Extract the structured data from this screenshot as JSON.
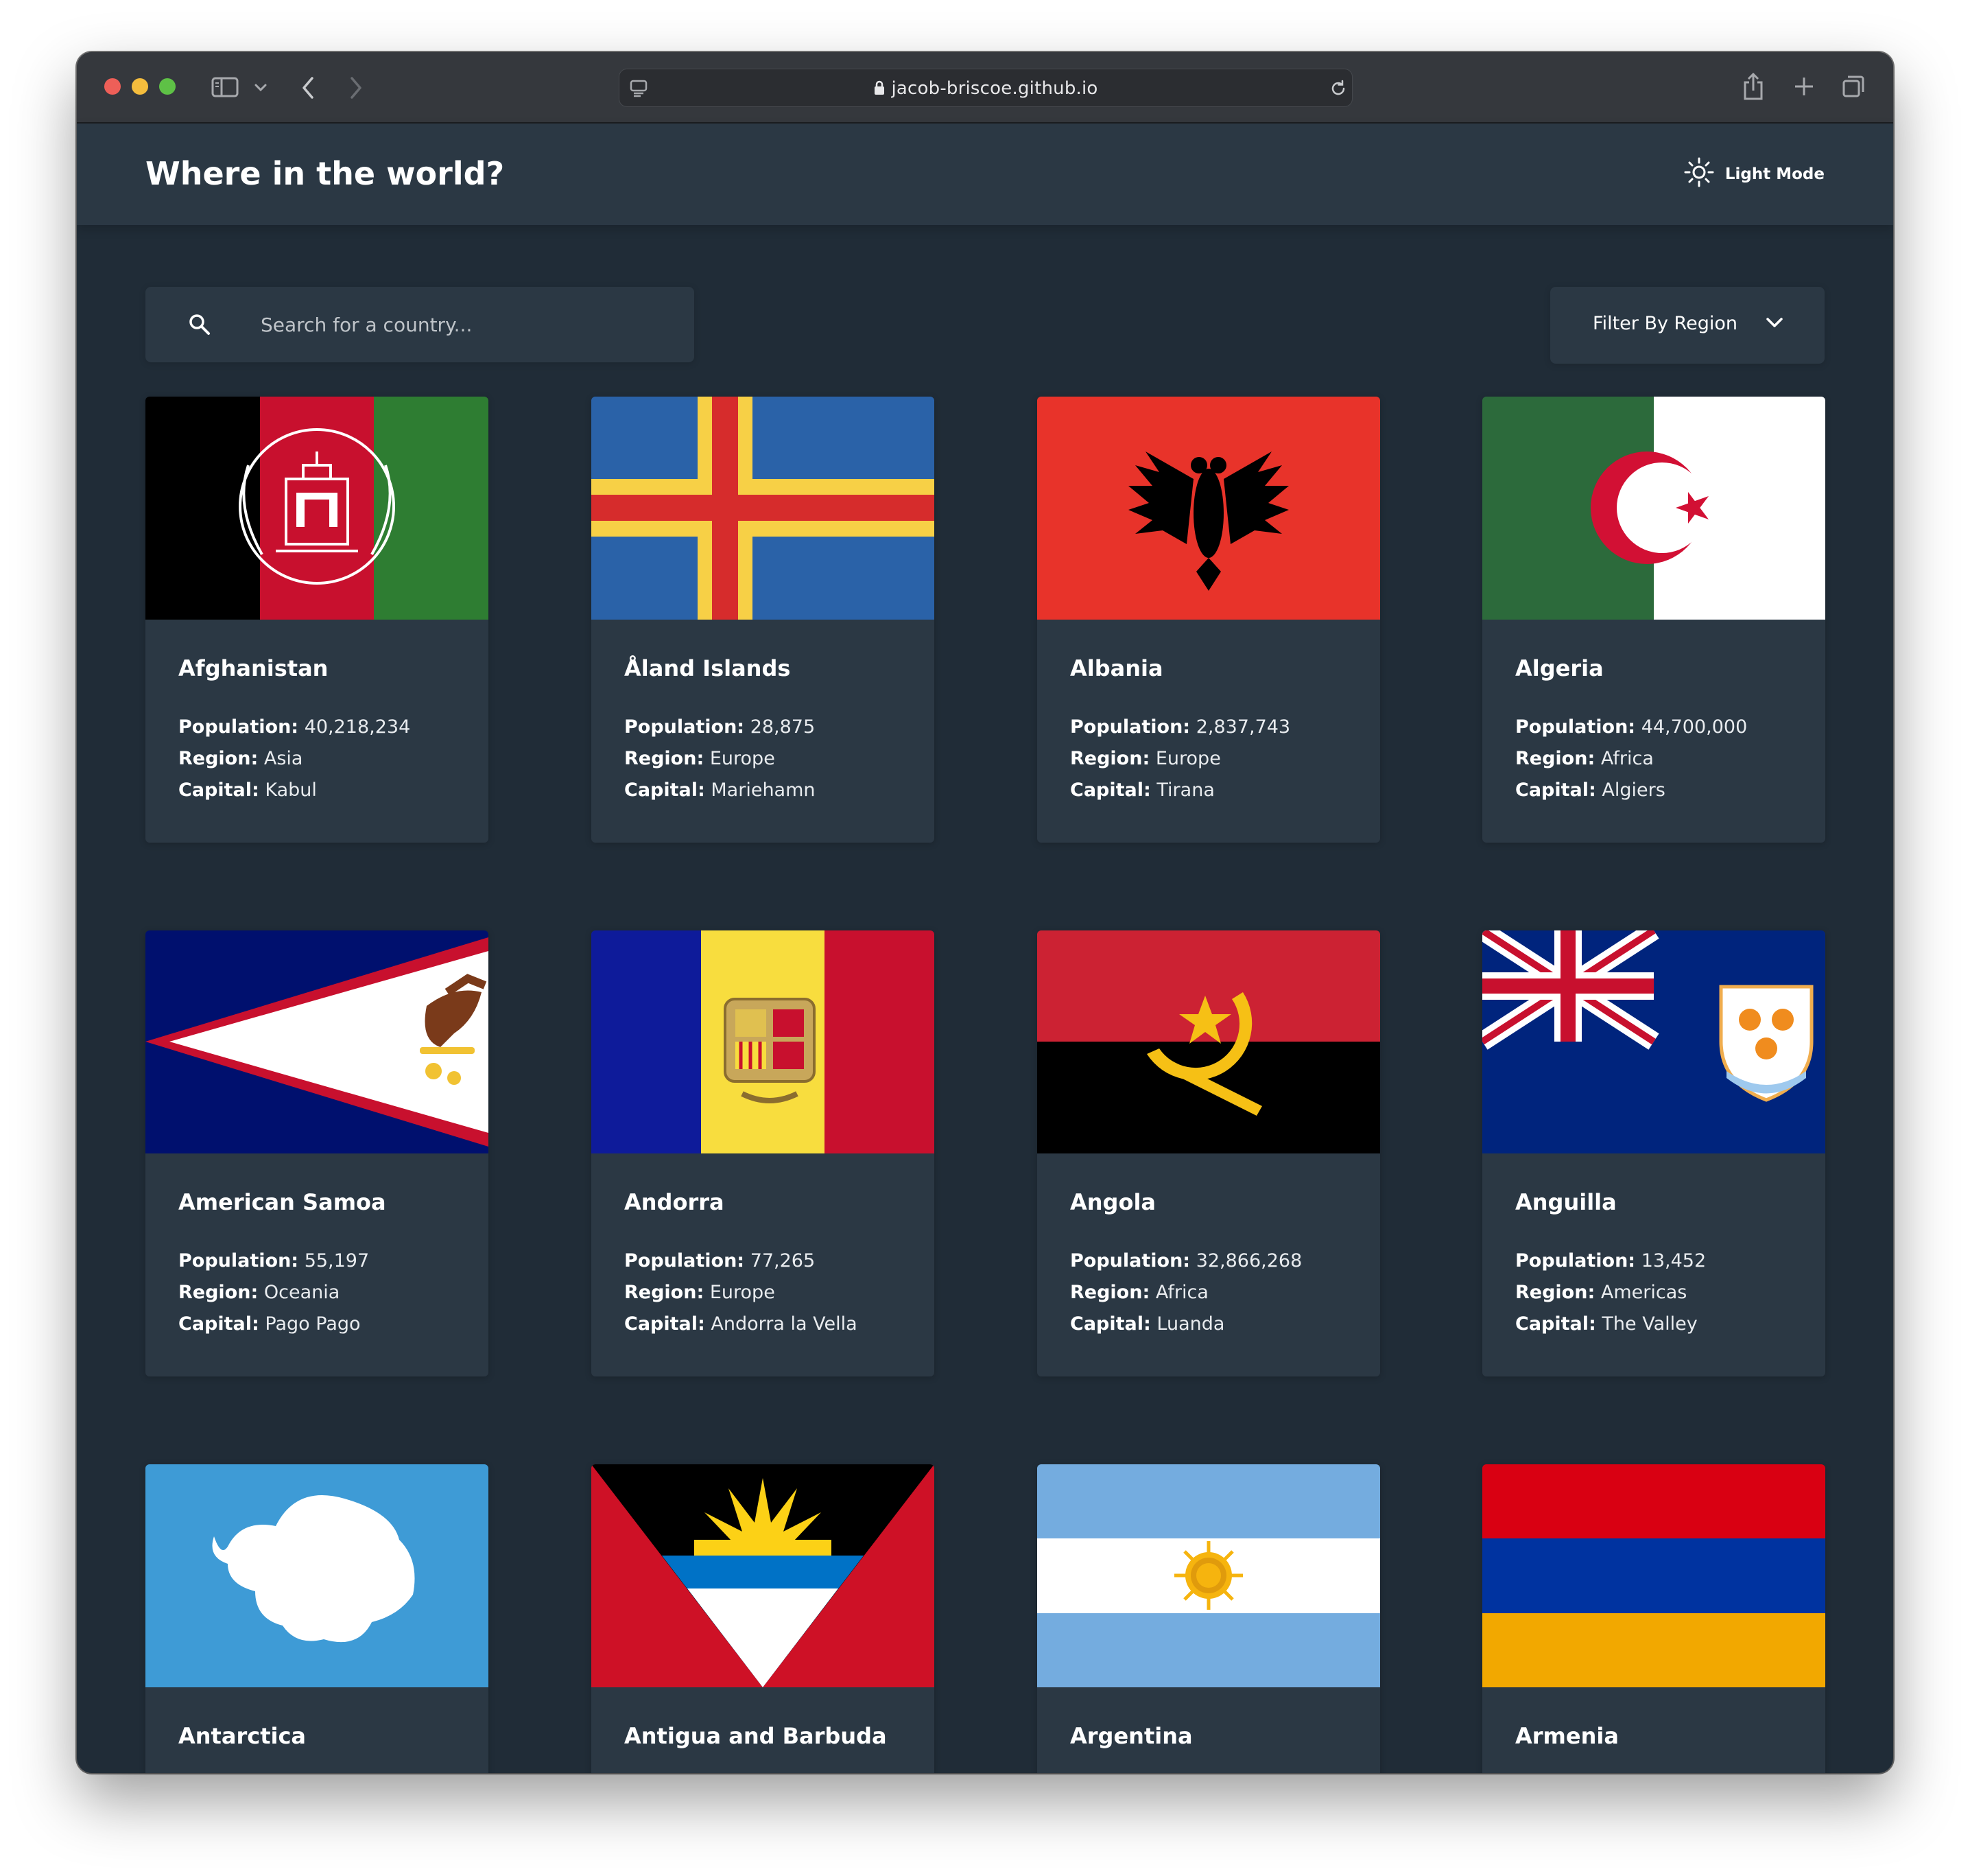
{
  "browser": {
    "url": "jacob-briscoe.github.io"
  },
  "header": {
    "title": "Where in the world?",
    "mode_label": "Light Mode"
  },
  "search": {
    "placeholder": "Search for a country..."
  },
  "filter": {
    "label": "Filter By Region"
  },
  "labels": {
    "population": "Population:",
    "region": "Region:",
    "capital": "Capital:"
  },
  "countries": [
    {
      "name": "Afghanistan",
      "population": "40,218,234",
      "region": "Asia",
      "capital": "Kabul",
      "flag_icon": "afghanistan-flag"
    },
    {
      "name": "Åland Islands",
      "population": "28,875",
      "region": "Europe",
      "capital": "Mariehamn",
      "flag_icon": "aland-islands-flag"
    },
    {
      "name": "Albania",
      "population": "2,837,743",
      "region": "Europe",
      "capital": "Tirana",
      "flag_icon": "albania-flag"
    },
    {
      "name": "Algeria",
      "population": "44,700,000",
      "region": "Africa",
      "capital": "Algiers",
      "flag_icon": "algeria-flag"
    },
    {
      "name": "American Samoa",
      "population": "55,197",
      "region": "Oceania",
      "capital": "Pago Pago",
      "flag_icon": "american-samoa-flag"
    },
    {
      "name": "Andorra",
      "population": "77,265",
      "region": "Europe",
      "capital": "Andorra la Vella",
      "flag_icon": "andorra-flag"
    },
    {
      "name": "Angola",
      "population": "32,866,268",
      "region": "Africa",
      "capital": "Luanda",
      "flag_icon": "angola-flag"
    },
    {
      "name": "Anguilla",
      "population": "13,452",
      "region": "Americas",
      "capital": "The Valley",
      "flag_icon": "anguilla-flag"
    },
    {
      "name": "Antarctica",
      "flag_icon": "antarctica-flag"
    },
    {
      "name": "Antigua and Barbuda",
      "flag_icon": "antigua-and-barbuda-flag"
    },
    {
      "name": "Argentina",
      "flag_icon": "argentina-flag"
    },
    {
      "name": "Armenia",
      "flag_icon": "armenia-flag"
    }
  ],
  "colors": {
    "background": "#202c37",
    "element": "#2b3844",
    "text": "#ffffff"
  }
}
